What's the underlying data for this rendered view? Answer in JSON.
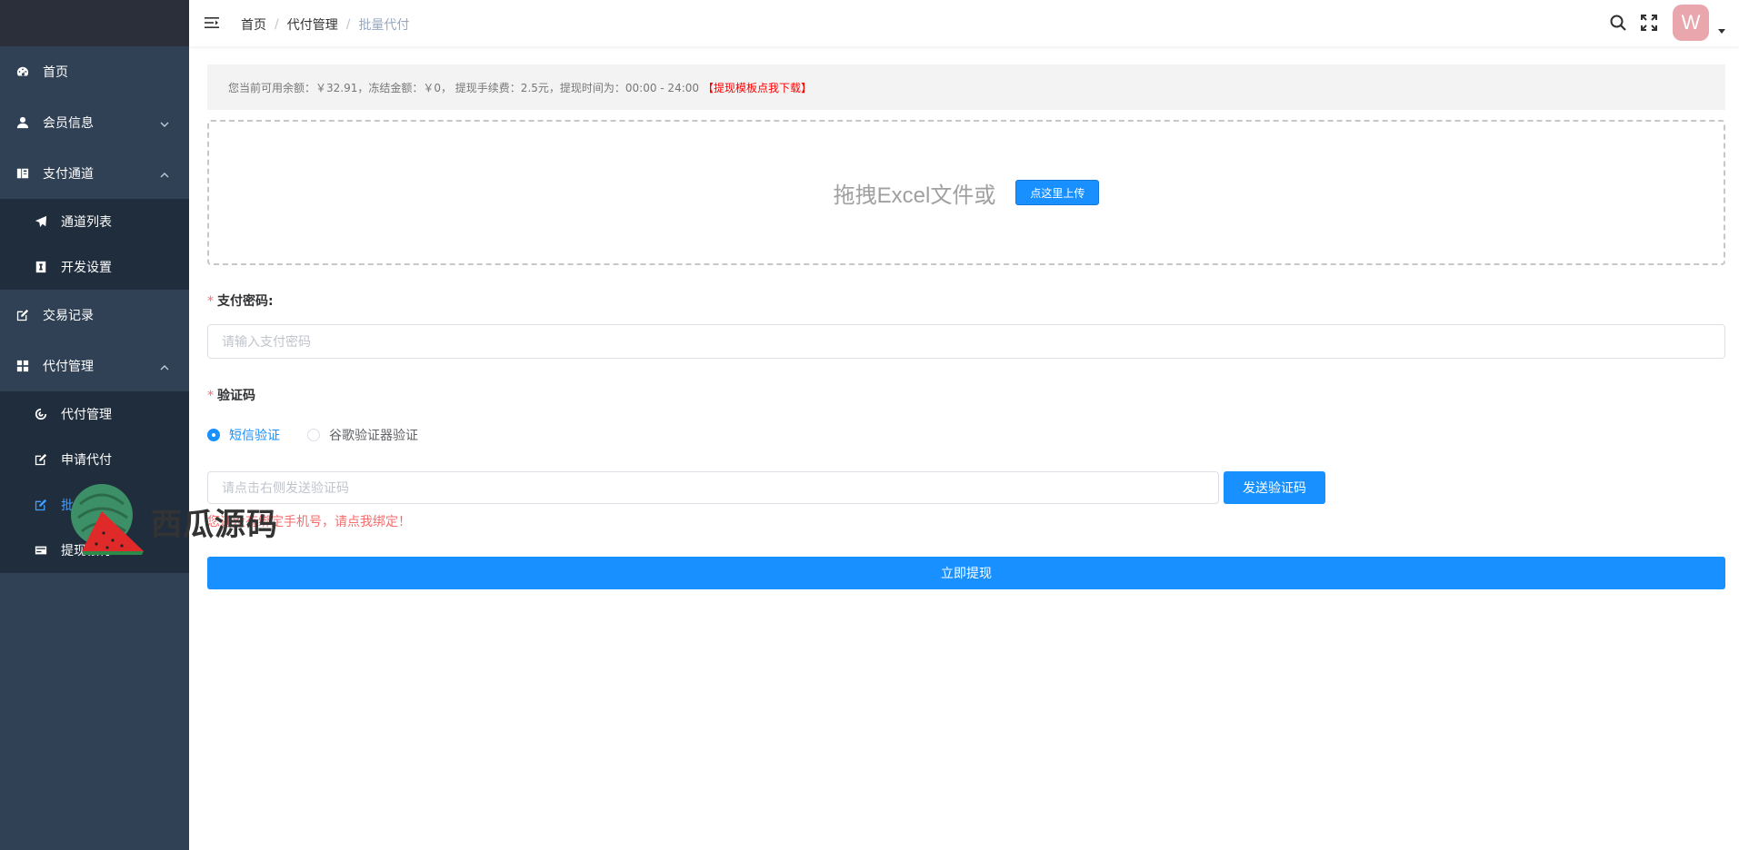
{
  "sidebar": {
    "items": [
      {
        "label": "首页",
        "icon": "dashboard-icon"
      },
      {
        "label": "会员信息",
        "icon": "user-icon",
        "expanded": false
      },
      {
        "label": "支付通道",
        "icon": "book-icon",
        "expanded": true,
        "children": [
          {
            "label": "通道列表",
            "icon": "send-icon"
          },
          {
            "label": "开发设置",
            "icon": "code-icon"
          }
        ]
      },
      {
        "label": "交易记录",
        "icon": "edit-icon"
      },
      {
        "label": "代付管理",
        "icon": "grid-icon",
        "expanded": true,
        "children": [
          {
            "label": "代付管理",
            "icon": "target-icon"
          },
          {
            "label": "申请代付",
            "icon": "edit-icon"
          },
          {
            "label": "批",
            "icon": "edit-icon",
            "active": true
          },
          {
            "label": "提现银行",
            "icon": "card-icon"
          }
        ]
      }
    ]
  },
  "header": {
    "breadcrumb": [
      "首页",
      "代付管理",
      "批量代付"
    ],
    "avatar_letter": "W"
  },
  "notice": {
    "text": "您当前可用余额：￥32.91，冻结金额：￥0， 提现手续费：2.5元，提现时间为：00:00 - 24:00",
    "link": "【提现模板点我下载】"
  },
  "upload": {
    "text": "拖拽Excel文件或",
    "button": "点这里上传"
  },
  "form": {
    "password_label": "支付密码:",
    "password_placeholder": "请输入支付密码",
    "code_label": "验证码",
    "radio_sms": "短信验证",
    "radio_google": "谷歌验证器验证",
    "code_placeholder": "请点击右侧发送验证码",
    "send_button": "发送验证码",
    "error": "您还没有绑定手机号，请点我绑定！",
    "submit": "立即提现"
  },
  "watermark": "西瓜源码",
  "colors": {
    "sidebar": "#304156",
    "submenu": "#1f2d3d",
    "primary": "#1890ff",
    "error": "#f56c6c"
  }
}
